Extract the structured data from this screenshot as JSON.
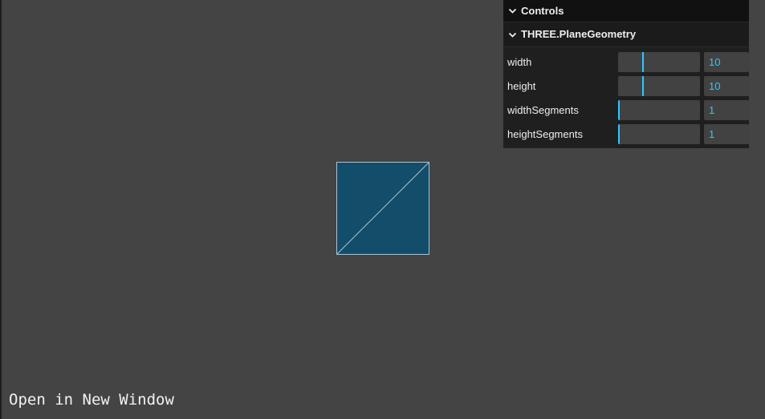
{
  "scene": {
    "mesh_color": "#124d6a",
    "wire_color": "#a9c4d3",
    "background_color": "#444444"
  },
  "open_link": "Open in New Window",
  "gui": {
    "title": "Controls",
    "folder": {
      "title": "THREE.PlaneGeometry",
      "controls": [
        {
          "label": "width",
          "value": "10",
          "fraction": 0.3
        },
        {
          "label": "height",
          "value": "10",
          "fraction": 0.3
        },
        {
          "label": "widthSegments",
          "value": "1",
          "fraction": 0.0
        },
        {
          "label": "heightSegments",
          "value": "1",
          "fraction": 0.0
        }
      ]
    },
    "accent_color": "#2cc9ff"
  }
}
